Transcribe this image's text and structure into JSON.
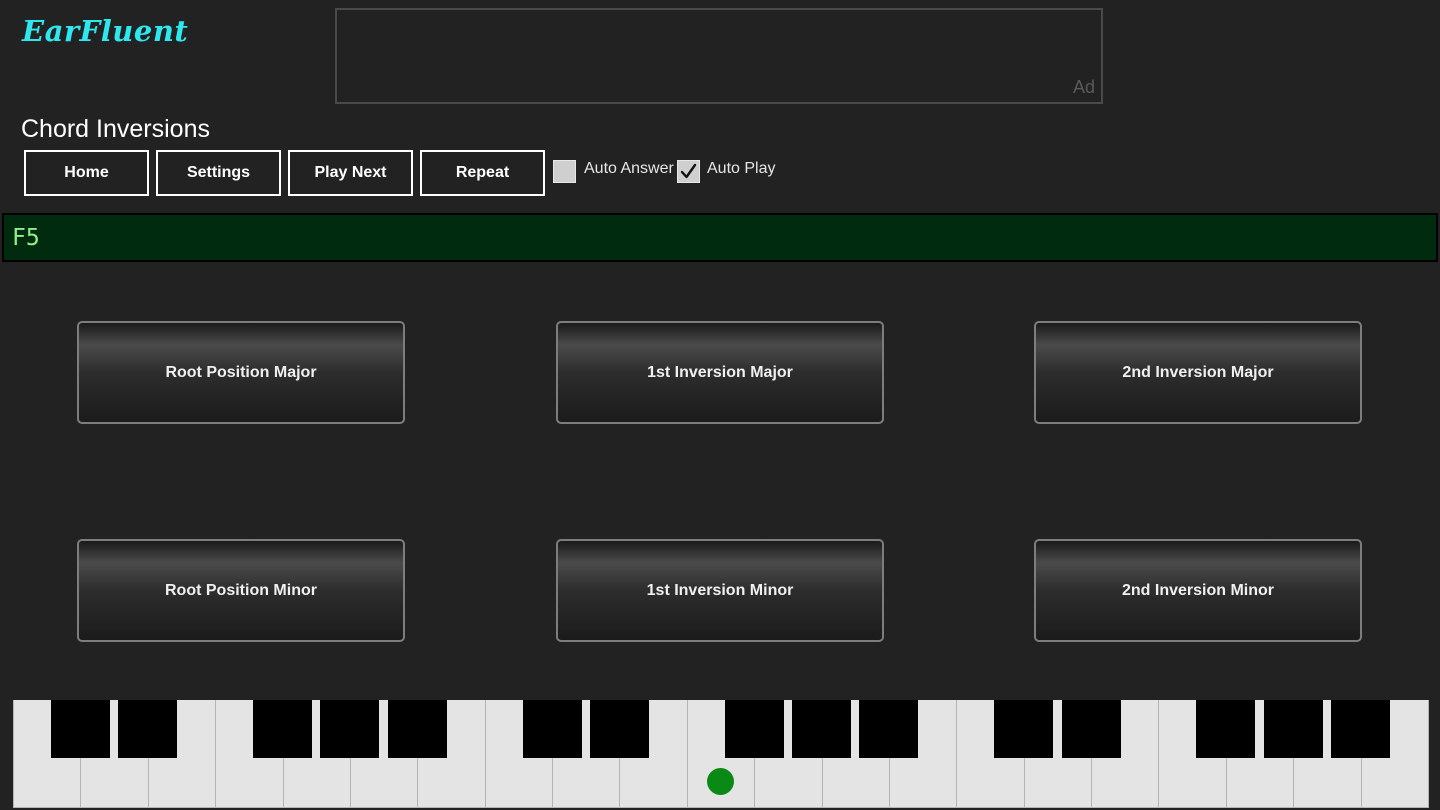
{
  "app": {
    "logo": "EarFluent"
  },
  "ad": {
    "label": "Ad"
  },
  "page": {
    "title": "Chord Inversions"
  },
  "toolbar": {
    "home": "Home",
    "settings": "Settings",
    "play_next": "Play Next",
    "repeat": "Repeat"
  },
  "options": {
    "auto_answer": {
      "label": "Auto Answer",
      "checked": false
    },
    "auto_play": {
      "label": "Auto Play",
      "checked": true
    }
  },
  "display": {
    "text": "F5"
  },
  "answers": [
    {
      "label": "Root Position Major"
    },
    {
      "label": "1st Inversion Major"
    },
    {
      "label": "2nd Inversion Major"
    },
    {
      "label": "Root Position Minor"
    },
    {
      "label": "1st Inversion Minor"
    },
    {
      "label": "2nd Inversion Minor"
    }
  ],
  "piano": {
    "white_keys": 21,
    "marked_key_index": 10
  },
  "colors": {
    "background": "#222222",
    "logo": "#2ee8ef",
    "display_bg": "#002b0e",
    "display_text": "#8df08d",
    "marker": "#0a8a14"
  }
}
